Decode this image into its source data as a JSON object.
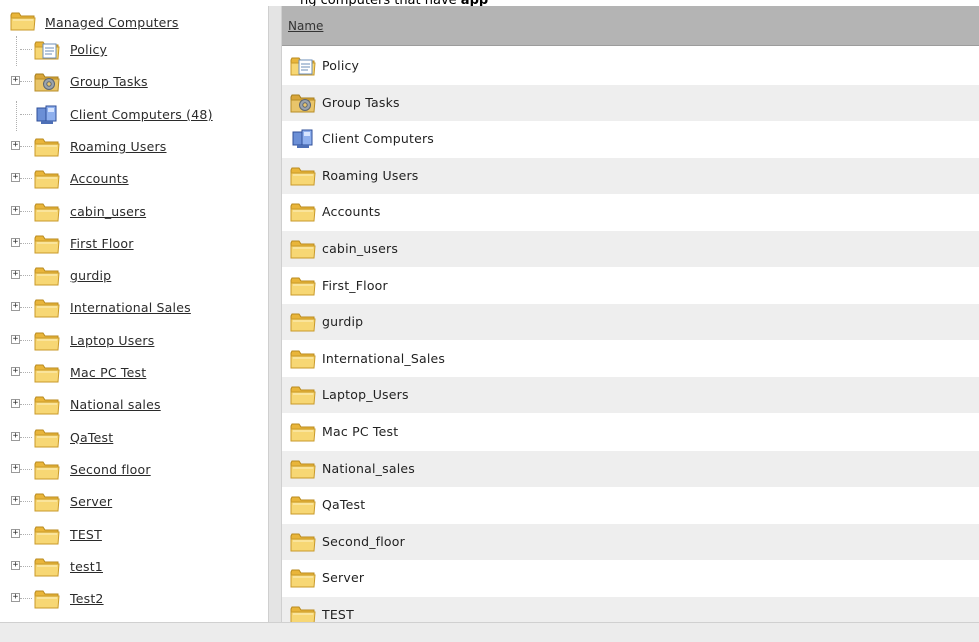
{
  "header": {
    "partial_text_prefix": "ng computers that have ",
    "partial_text_bold": "app"
  },
  "tree": {
    "root": {
      "label": "Managed Computers",
      "icon": "folder-icon"
    },
    "items": [
      {
        "label": "Policy",
        "icon": "policy-icon",
        "expandable": false
      },
      {
        "label": "Group Tasks",
        "icon": "group-tasks-icon",
        "expandable": true
      },
      {
        "label": "Client Computers (48)",
        "icon": "client-computers-icon",
        "expandable": false
      },
      {
        "label": "Roaming Users",
        "icon": "folder-icon",
        "expandable": true
      },
      {
        "label": "Accounts",
        "icon": "folder-icon",
        "expandable": true
      },
      {
        "label": "cabin_users",
        "icon": "folder-icon",
        "expandable": true
      },
      {
        "label": "First Floor",
        "icon": "folder-icon",
        "expandable": true
      },
      {
        "label": "gurdip",
        "icon": "folder-icon",
        "expandable": true
      },
      {
        "label": "International Sales",
        "icon": "folder-icon",
        "expandable": true
      },
      {
        "label": "Laptop Users",
        "icon": "folder-icon",
        "expandable": true
      },
      {
        "label": "Mac PC Test",
        "icon": "folder-icon",
        "expandable": true
      },
      {
        "label": "National sales",
        "icon": "folder-icon",
        "expandable": true
      },
      {
        "label": "QaTest",
        "icon": "folder-icon",
        "expandable": true
      },
      {
        "label": "Second floor",
        "icon": "folder-icon",
        "expandable": true
      },
      {
        "label": "Server",
        "icon": "folder-icon",
        "expandable": true
      },
      {
        "label": "TEST",
        "icon": "folder-icon",
        "expandable": true
      },
      {
        "label": "test1",
        "icon": "folder-icon",
        "expandable": true
      },
      {
        "label": "Test2",
        "icon": "folder-icon",
        "expandable": true
      }
    ]
  },
  "list": {
    "column_header": "Name",
    "rows": [
      {
        "label": "Policy",
        "icon": "policy-icon"
      },
      {
        "label": "Group Tasks",
        "icon": "group-tasks-icon"
      },
      {
        "label": "Client Computers",
        "icon": "client-computers-icon"
      },
      {
        "label": "Roaming Users",
        "icon": "folder-icon"
      },
      {
        "label": "Accounts",
        "icon": "folder-icon"
      },
      {
        "label": "cabin_users",
        "icon": "folder-icon"
      },
      {
        "label": "First_Floor",
        "icon": "folder-icon"
      },
      {
        "label": "gurdip",
        "icon": "folder-icon"
      },
      {
        "label": "International_Sales",
        "icon": "folder-icon"
      },
      {
        "label": "Laptop_Users",
        "icon": "folder-icon"
      },
      {
        "label": "Mac PC Test",
        "icon": "folder-icon"
      },
      {
        "label": "National_sales",
        "icon": "folder-icon"
      },
      {
        "label": "QaTest",
        "icon": "folder-icon"
      },
      {
        "label": "Second_floor",
        "icon": "folder-icon"
      },
      {
        "label": "Server",
        "icon": "folder-icon"
      },
      {
        "label": "TEST",
        "icon": "folder-icon"
      }
    ]
  },
  "colors": {
    "header_bg": "#b4b4b4",
    "row_alt": "#eeeeee",
    "folder": "#f2c84b",
    "link": "#2b2b2b"
  }
}
